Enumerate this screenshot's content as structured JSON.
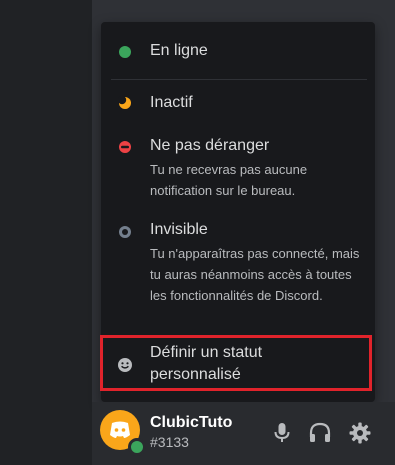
{
  "status_menu": {
    "items": [
      {
        "id": "online",
        "label": "En ligne",
        "color": "#3ba55c"
      },
      {
        "id": "idle",
        "label": "Inactif",
        "color": "#faa61a"
      },
      {
        "id": "dnd",
        "label": "Ne pas déranger",
        "color": "#ed4245",
        "description": "Tu ne recevras pas aucune notification sur le bureau."
      },
      {
        "id": "invisible",
        "label": "Invisible",
        "color": "#747f8d",
        "description": "Tu n'apparaîtras pas connecté, mais tu auras néanmoins accès à toutes les fonctionnalités de Discord."
      },
      {
        "id": "custom",
        "label": "Définir un statut personnalisé",
        "icon": "smiley-icon"
      }
    ]
  },
  "user": {
    "name": "ClubicTuto",
    "tag": "#3133",
    "avatar_color": "#faa61a",
    "status_color": "#3ba55c"
  },
  "controls": [
    "microphone-icon",
    "headphones-icon",
    "settings-gear-icon"
  ],
  "highlight_color": "#e0232b"
}
